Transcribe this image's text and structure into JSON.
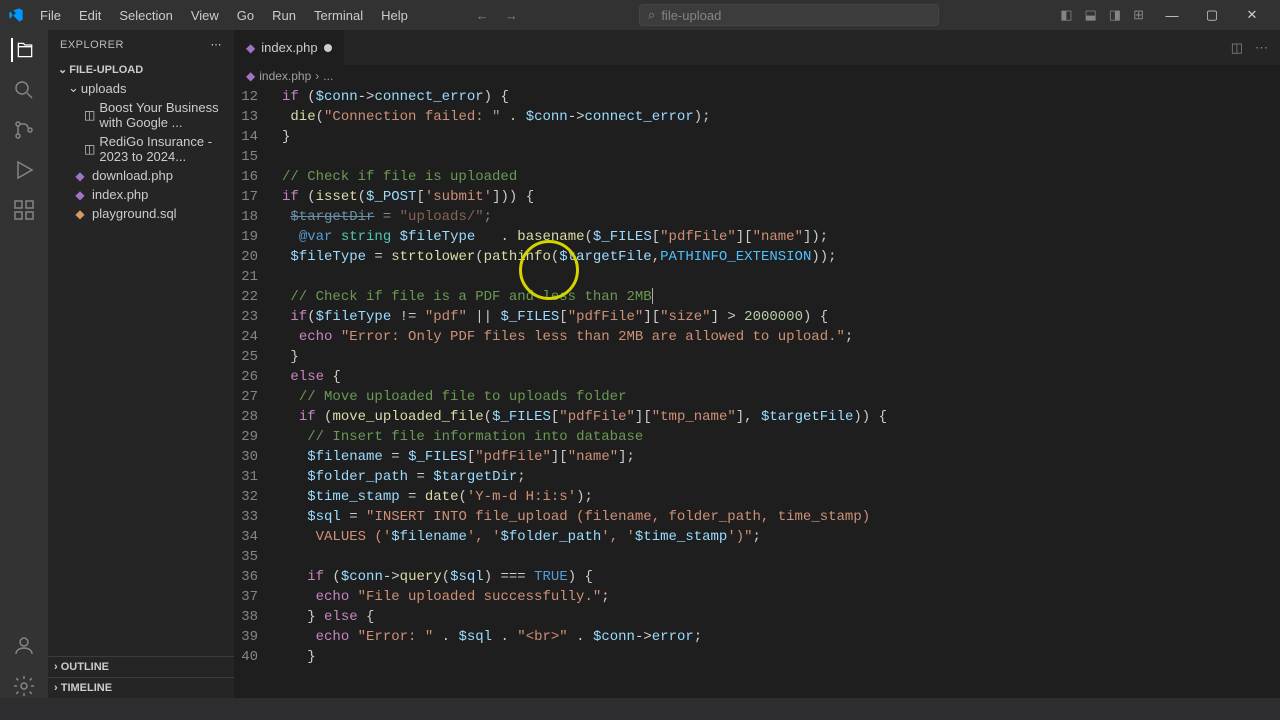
{
  "menus": [
    "File",
    "Edit",
    "Selection",
    "View",
    "Go",
    "Run",
    "Terminal",
    "Help"
  ],
  "search": {
    "placeholder": "file-upload"
  },
  "explorer": {
    "title": "EXPLORER",
    "root": "FILE-UPLOAD",
    "subfolder": "uploads",
    "files": [
      {
        "name": "Boost Your Business with Google ...",
        "icon": "◫"
      },
      {
        "name": "RediGo Insurance - 2023 to 2024...",
        "icon": "◫"
      }
    ],
    "rootFiles": [
      {
        "name": "download.php",
        "cls": "php"
      },
      {
        "name": "index.php",
        "cls": "php"
      },
      {
        "name": "playground.sql",
        "cls": "sql"
      }
    ],
    "outline": "OUTLINE",
    "timeline": "TIMELINE"
  },
  "tab": {
    "name": "index.php",
    "breadcrumb": "index.php",
    "sep": "›",
    "more": "..."
  },
  "code": {
    "lines": [
      {
        "n": 12,
        "html": "<span class='kw'>if</span> (<span class='var'>$conn</span><span class='op'>-></span><span class='prop'>connect_error</span>) {"
      },
      {
        "n": 13,
        "html": " <span class='fn'>die</span>(<span class='str'>\"Connection failed: \"</span> . <span class='var'>$conn</span><span class='op'>-></span><span class='prop'>connect_error</span>);"
      },
      {
        "n": 14,
        "html": "}"
      },
      {
        "n": 15,
        "html": ""
      },
      {
        "n": 16,
        "html": "<span class='cmt'>// Check if file is uploaded</span>"
      },
      {
        "n": 17,
        "html": "<span class='kw'>if</span> (<span class='fn'>isset</span>(<span class='var'>$_POST</span>[<span class='str'>'submit'</span>])) {"
      },
      {
        "n": 18,
        "html": " <span class='var' style='text-decoration:line-through;opacity:0.6'>$targetDir</span> <span style='opacity:0.6'>= </span><span class='str' style='opacity:0.6'>\"uploads/\"</span><span style='opacity:0.6'>;</span>"
      },
      {
        "n": 19,
        "html": "  <span class='doc'>@var</span> <span class='type'>string</span> <span class='var'>$fileType</span>   . <span class='fn'>basename</span>(<span class='var'>$_FILES</span>[<span class='str'>\"pdfFile\"</span>][<span class='str'>\"name\"</span>]);"
      },
      {
        "n": 20,
        "html": " <span class='var'>$fileType</span> = <span class='fn'>strtolower</span>(<span class='fn'>pathinfo</span>(<span class='var'>$targetFile</span>,<span class='const'>PATHINFO_EXTENSION</span>));"
      },
      {
        "n": 21,
        "html": ""
      },
      {
        "n": 22,
        "html": " <span class='cmt'>// Check if file is a PDF and less than 2MB</span><span class='cursor-bar'></span>"
      },
      {
        "n": 23,
        "html": " <span class='kw'>if</span>(<span class='var'>$fileType</span> != <span class='str'>\"pdf\"</span> || <span class='var'>$_FILES</span>[<span class='str'>\"pdfFile\"</span>][<span class='str'>\"size\"</span>] > <span class='num'>2000000</span>) {"
      },
      {
        "n": 24,
        "html": "  <span class='kw'>echo</span> <span class='str'>\"Error: Only PDF files less than 2MB are allowed to upload.\"</span>;"
      },
      {
        "n": 25,
        "html": " }"
      },
      {
        "n": 26,
        "html": " <span class='kw'>else</span> {"
      },
      {
        "n": 27,
        "html": "  <span class='cmt'>// Move uploaded file to uploads folder</span>"
      },
      {
        "n": 28,
        "html": "  <span class='kw'>if</span> (<span class='fn'>move_uploaded_file</span>(<span class='var'>$_FILES</span>[<span class='str'>\"pdfFile\"</span>][<span class='str'>\"tmp_name\"</span>], <span class='var'>$targetFile</span>)) {"
      },
      {
        "n": 29,
        "html": "   <span class='cmt'>// Insert file information into database</span>"
      },
      {
        "n": 30,
        "html": "   <span class='var'>$filename</span> = <span class='var'>$_FILES</span>[<span class='str'>\"pdfFile\"</span>][<span class='str'>\"name\"</span>];"
      },
      {
        "n": 31,
        "html": "   <span class='var'>$folder_path</span> = <span class='var'>$targetDir</span>;"
      },
      {
        "n": 32,
        "html": "   <span class='var'>$time_stamp</span> = <span class='fn'>date</span>(<span class='str'>'Y-m-d H:i:s'</span>);"
      },
      {
        "n": 33,
        "html": "   <span class='var'>$sql</span> = <span class='str'>\"INSERT INTO file_upload (filename, folder_path, time_stamp)</span>"
      },
      {
        "n": 34,
        "html": "    <span class='str'>VALUES ('</span><span class='var'>$filename</span><span class='str'>', '</span><span class='var'>$folder_path</span><span class='str'>', '</span><span class='var'>$time_stamp</span><span class='str'>')\"</span>;"
      },
      {
        "n": 35,
        "html": ""
      },
      {
        "n": 36,
        "html": "   <span class='kw'>if</span> (<span class='var'>$conn</span><span class='op'>-></span><span class='fn'>query</span>(<span class='var'>$sql</span>) === <span class='bool'>TRUE</span>) {"
      },
      {
        "n": 37,
        "html": "    <span class='kw'>echo</span> <span class='str'>\"File uploaded successfully.\"</span>;"
      },
      {
        "n": 38,
        "html": "   } <span class='kw'>else</span> {"
      },
      {
        "n": 39,
        "html": "    <span class='kw'>echo</span> <span class='str'>\"Error: \"</span> . <span class='var'>$sql</span> . <span class='str'>\"&lt;br&gt;\"</span> . <span class='var'>$conn</span><span class='op'>-></span><span class='prop'>error</span>;"
      },
      {
        "n": 40,
        "html": "   }"
      }
    ]
  }
}
